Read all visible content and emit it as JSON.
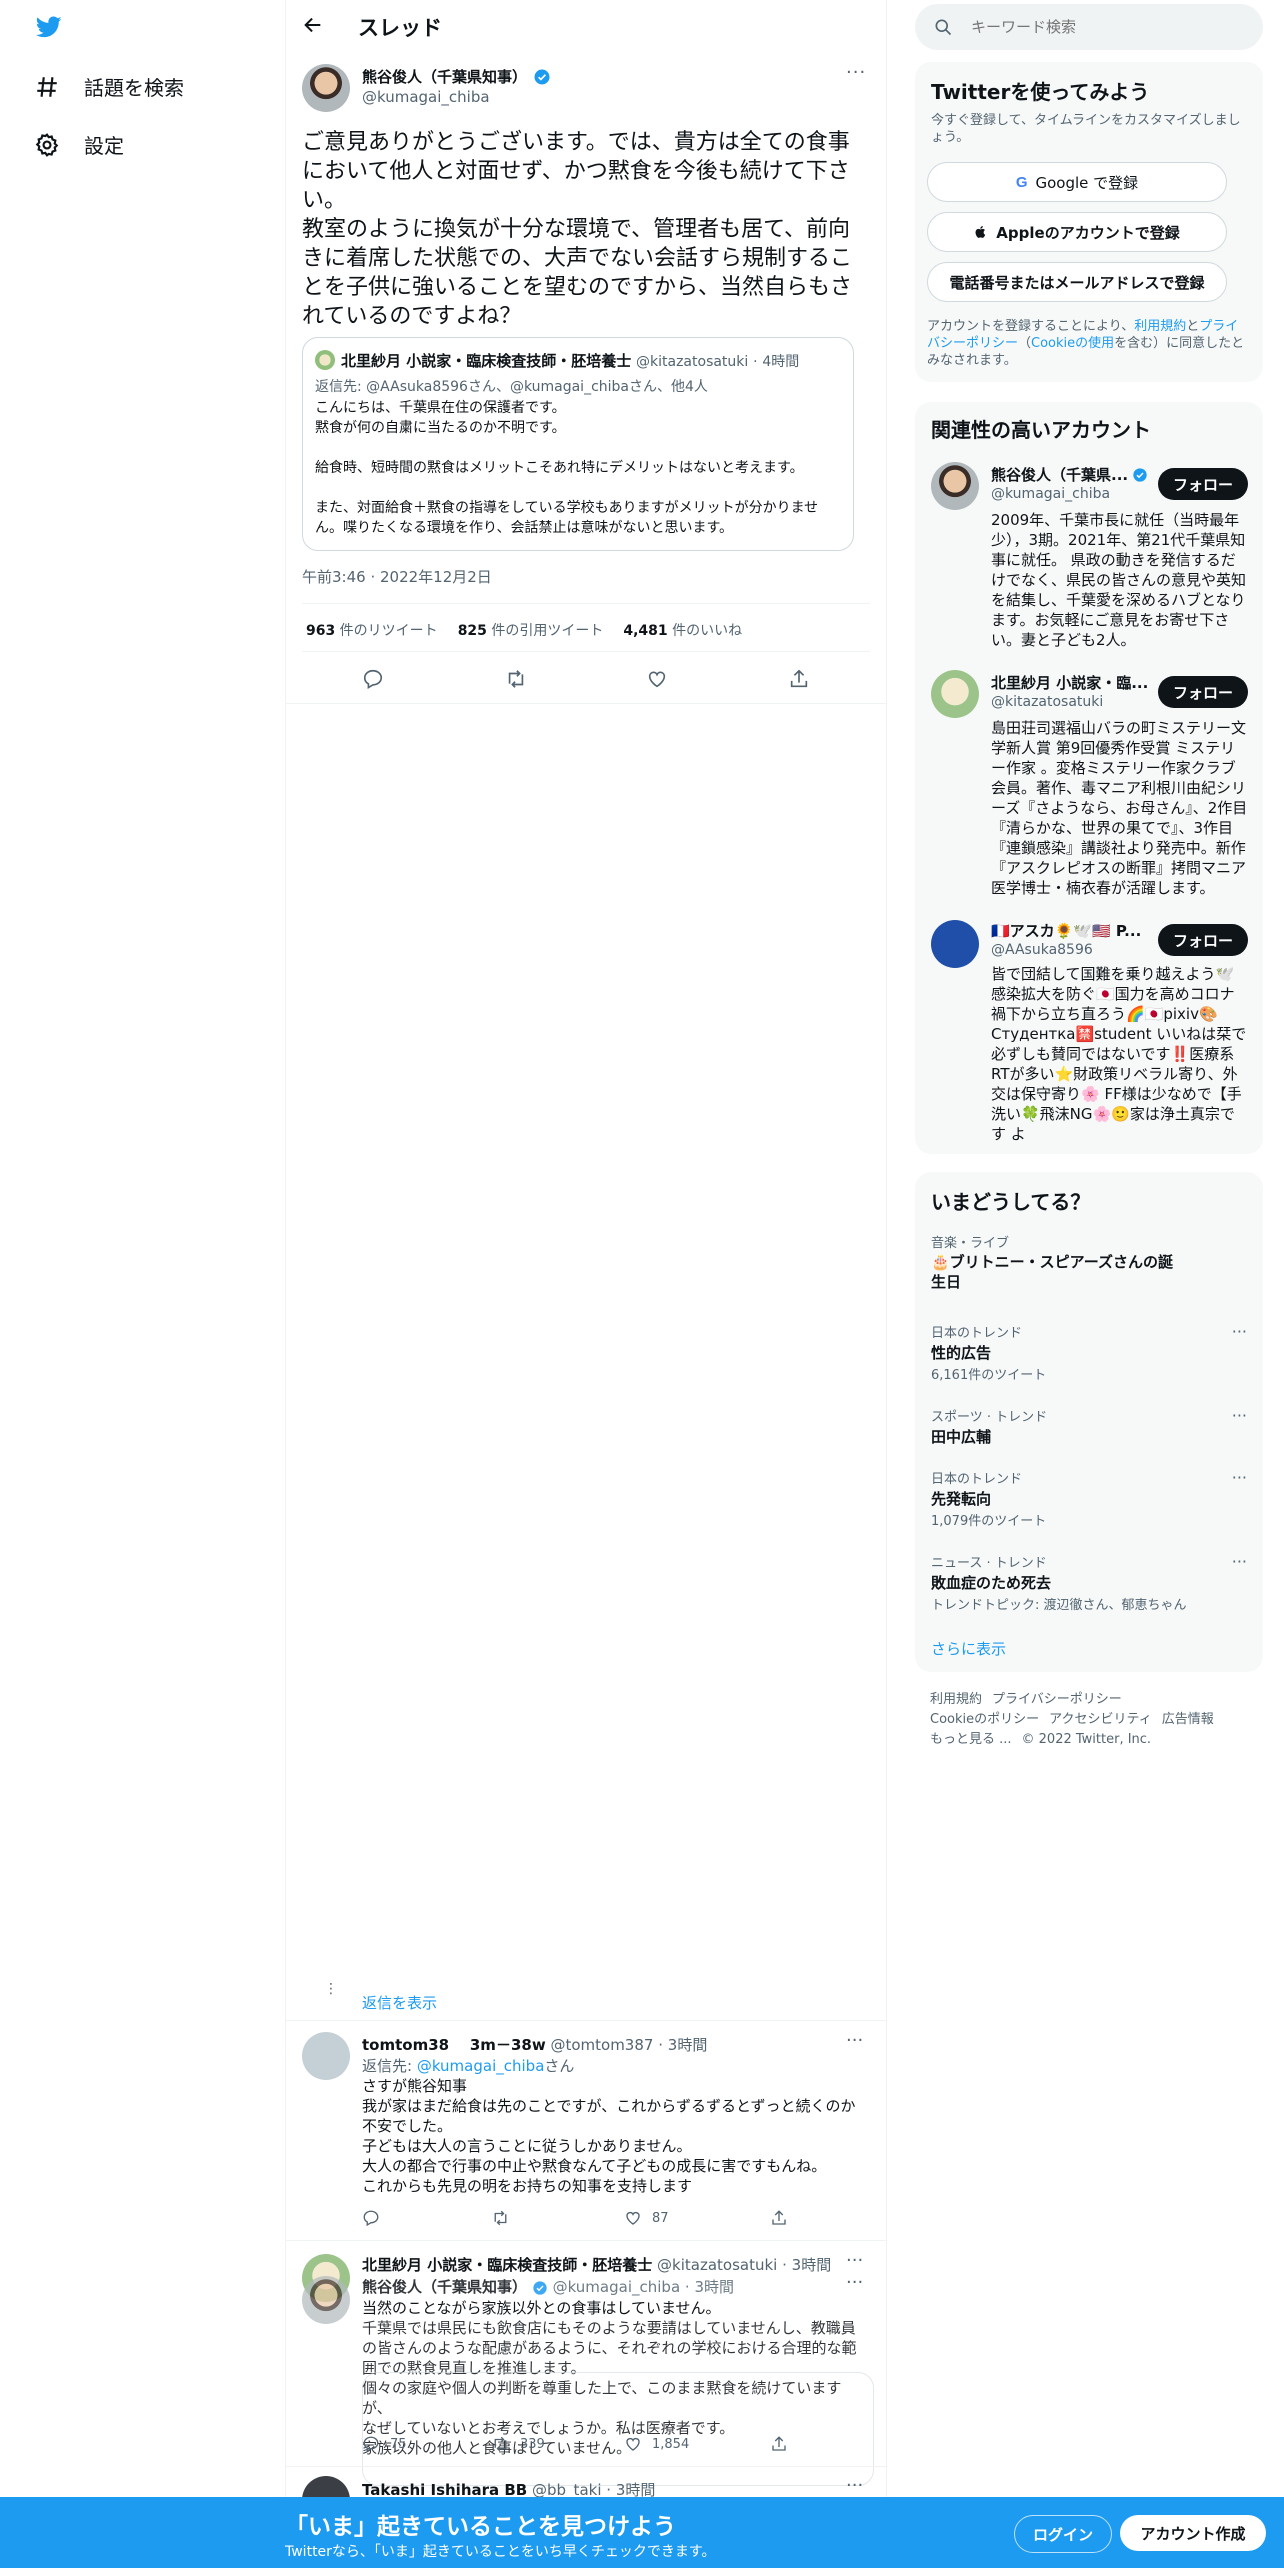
{
  "nav": {
    "items": [
      {
        "label": "話題を検索",
        "icon": "hashtag-icon"
      },
      {
        "label": "設定",
        "icon": "gear-icon"
      }
    ]
  },
  "header": {
    "title": "スレッド"
  },
  "main_tweet": {
    "name": "熊谷俊人（千葉県知事）",
    "handle": "@kumagai_chiba",
    "text": "ご意見ありがとうございます。では、貴方は全ての食事において他人と対面せず、かつ黙食を今後も続けて下さい。\n教室のように換気が十分な環境で、管理者も居て、前向きに着席した状態での、大声でない会話すら規制することを子供に強いることを望むのですから、当然自らもされているのですよね？",
    "quoted": {
      "name": "北里紗月 小説家・臨床検査技師・胚培養士",
      "handle": "@kitazatosatuki",
      "time": "4時間",
      "reply_to": "返信先: @AAsuka8596さん、@kumagai_chibaさん、他4人",
      "text": "こんにちは、千葉県在住の保護者です。\n黙食が何の自粛に当たるのか不明です。\n\n給食時、短時間の黙食はメリットこそあれ特にデメリットはないと考えます。\n\nまた、対面給食＋黙食の指導をしている学校もありますがメリットが分かりません。喋りたくなる環境を作り、会話禁止は意味がないと思います。"
    },
    "timestamp": "午前3:46 · 2022年12月2日",
    "stats": [
      {
        "count": "963",
        "label": " 件のリツイート"
      },
      {
        "count": "825",
        "label": " 件の引用ツイート"
      },
      {
        "count": "4,481",
        "label": " 件のいいね"
      }
    ]
  },
  "show_replies": "返信を表示",
  "reply1": {
    "name": "tomtom38",
    "extra": "3m－38w",
    "handle": "@tomtom387",
    "time": "· 3時間",
    "reply_to_prefix": "返信先: ",
    "reply_to_handle": "@kumagai_chiba",
    "reply_to_suffix": "さん",
    "text": "さすが熊谷知事\n我が家はまだ給食は先のことですが、これからずるずるとずっと続くのか不安でした。\n子どもは大人の言うことに従うしかありません。\n大人の都合で行事の中止や黙食なんて子どもの成長に害ですもんね。\nこれからも先見の明をお持ちの知事を支持します",
    "likes": "87"
  },
  "reply2": {
    "name": "北里紗月 小説家・臨床検査技師・胚培養士",
    "handle": "@kitazatosatuki",
    "time": "· 3時間",
    "text": "当然のことながら家族以外との食事はしていません。",
    "replies": "75",
    "retweets": "339",
    "likes": "1,854"
  },
  "reply2_overlap": {
    "name": "熊谷俊人（千葉県知事）",
    "handle": "@kumagai_chiba",
    "time": "· 3時間",
    "text": "千葉県では県民にも飲食店にもそのような要請はしていませんし、教職員の皆さんのような配慮があるように、それぞれの学校における合理的な範囲での黙食見直しを推進します。\n個々の家庭や個人の判断を尊重した上で、このまま黙食を続けていますが、\nなぜしていないとお考えでしょうか。私は医療者です。\n家族以外の他人と食事はしていません。"
  },
  "reply3": {
    "name": "Takashi Ishihara BB",
    "handle": "@bb_taki",
    "time": "· 3時間"
  },
  "search": {
    "placeholder": "キーワード検索"
  },
  "signup": {
    "title": "Twitterを使ってみよう",
    "subtitle": "今すぐ登録して、タイムラインをカスタマイズしましょう。",
    "google": "Google で登録",
    "apple": "Appleのアカウントで登録",
    "phone": "電話番号またはメールアドレスで登録",
    "terms_1": "アカウントを登録することにより、",
    "terms_link1": "利用規約",
    "terms_2": "と",
    "terms_link2": "プライバシーポリシー",
    "terms_3": "（",
    "terms_link3": "Cookieの使用",
    "terms_4": "を含む）に同意したとみなされます。"
  },
  "related": {
    "title": "関連性の高いアカウント",
    "follow_label": "フォロー",
    "accounts": [
      {
        "name": "熊谷俊人（千葉県...",
        "handle": "@kumagai_chiba",
        "bio": "2009年、千葉市長に就任（当時最年少），3期。2021年、第21代千葉県知事に就任。 県政の動きを発信するだけでなく、県民の皆さんの意見や英知を結集し、千葉愛を深めるハブとなります。お気軽にご意見をお寄せ下さい。妻と子ども2人。"
      },
      {
        "name": "北里紗月 小説家・臨...",
        "handle": "@kitazatosatuki",
        "bio": "島田荘司選福山バラの町ミステリー文学新人賞 第9回優秀作受賞 ミステリー作家 。変格ミステリー作家クラブ会員。著作、毒マニア利根川由紀シリーズ『さようなら、お母さん』、2作目『清らかな、世界の果てで』、3作目『連鎖感染』講談社より発売中。新作『アスクレピオスの断罪』拷問マニア医学博士・楠衣春が活躍します。"
      },
      {
        "name": "🇫🇷アスカ🌻🕊️🇺🇸 P...",
        "handle": "@AAsuka8596",
        "bio": "皆で団結して国難を乗り越えよう🕊️感染拡大を防ぐ🇯🇵国力を高めコロナ禍下から立ち直ろう🌈🇯🇵pixiv🎨Студентка🈲student いいねは栞で必ずしも賛同ではないです‼️医療系RTが多い⭐財政策リベラル寄り、外交は保守寄り🌸 FF様は少なめで【手洗い🍀飛沫NG🌸🙂家は浄土真宗です よ"
      }
    ]
  },
  "trends": {
    "title": "いまどうしてる？",
    "items": [
      {
        "meta": "音楽・ライブ",
        "name": "🎂ブリトニー・スピアーズさんの誕生日",
        "count": ""
      },
      {
        "meta": "日本のトレンド",
        "name": "性的広告",
        "count": "6,161件のツイート"
      },
      {
        "meta": "スポーツ · トレンド",
        "name": "田中広輔",
        "count": ""
      },
      {
        "meta": "日本のトレンド",
        "name": "先発転向",
        "count": "1,079件のツイート"
      },
      {
        "meta": "ニュース · トレンド",
        "name": "敗血症のため死去",
        "count": "トレンドトピック: 渡辺徹さん、郁恵ちゃん"
      }
    ],
    "more": "さらに表示"
  },
  "footer": {
    "links": [
      "利用規約",
      "プライバシーポリシー",
      "Cookieのポリシー",
      "アクセシビリティ",
      "広告情報",
      "もっと見る ..."
    ],
    "copyright": "© 2022 Twitter, Inc."
  },
  "bottom_bar": {
    "title": "「いま」起きていることを見つけよう",
    "subtitle": "Twitterなら、「いま」起きていることをいち早くチェックできます。",
    "login": "ログイン",
    "signup": "アカウント作成"
  },
  "colors": {
    "accent": "#1d9bf0",
    "text": "#0f1419",
    "muted": "#536471",
    "border": "#eff3f4"
  }
}
